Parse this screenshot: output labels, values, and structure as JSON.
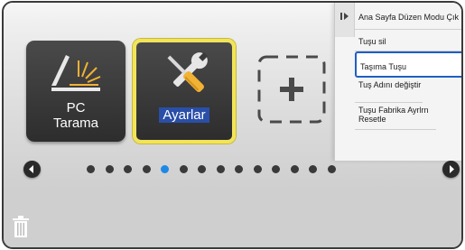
{
  "home": {
    "tiles": [
      {
        "label_line1": "PC",
        "label_line2": "Tarama",
        "icon": "scanner-icon"
      },
      {
        "label": "Ayarlar",
        "icon": "tools-icon",
        "selected": true
      }
    ],
    "add_tile_icon": "plus-icon"
  },
  "pager": {
    "dot_count": 14,
    "active_index": 4,
    "prev_icon": "chevron-left-icon",
    "next_icon": "chevron-right-icon"
  },
  "menu": {
    "collapse_icon": "collapse-arrow-icon",
    "items": [
      {
        "label": "Ana Sayfa Düzen Modu Çık"
      },
      {
        "label": "Tuşu sil"
      },
      {
        "label": "Taşıma Tuşu",
        "selected": true
      },
      {
        "label": "Tuş Adını değiştir"
      },
      {
        "label": "Tuşu Fabrika Ayrlrn Resetle"
      }
    ]
  },
  "trash_icon": "trash-icon",
  "colors": {
    "selected_tile_border": "#f2e45a",
    "label_highlight": "#2a4fa8",
    "selected_menu_border": "#1f5fc4",
    "active_dot": "#1e88e5",
    "scanner_light": "#f2b233"
  }
}
